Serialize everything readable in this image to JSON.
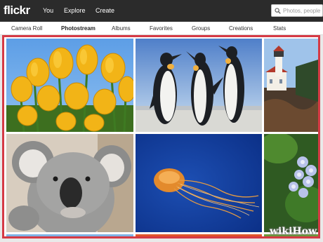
{
  "topbar": {
    "logo": "flickr",
    "nav": [
      "You",
      "Explore",
      "Create"
    ],
    "search_placeholder": "Photos, people"
  },
  "subnav": {
    "items": [
      "Camera Roll",
      "Photostream",
      "Albums",
      "Favorites",
      "Groups",
      "Creations",
      "Stats"
    ],
    "active": "Photostream"
  },
  "photos": [
    {
      "subject": "yellow tulips"
    },
    {
      "subject": "penguins"
    },
    {
      "subject": "lighthouse"
    },
    {
      "subject": "koala"
    },
    {
      "subject": "jellyfish"
    },
    {
      "subject": "hydrangea flowers"
    }
  ],
  "watermark": {
    "text": "wikiHow"
  },
  "colors": {
    "topbar": "#2b2b2b",
    "selection_border": "#d53a45"
  }
}
